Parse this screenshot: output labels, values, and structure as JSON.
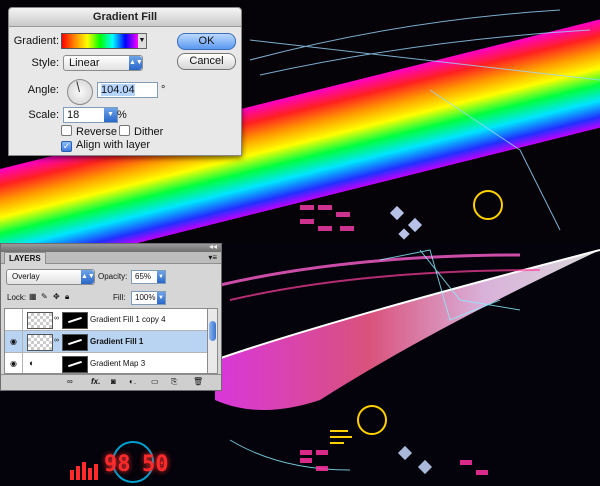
{
  "dialog": {
    "title": "Gradient Fill",
    "gradient_label": "Gradient:",
    "style_label": "Style:",
    "style_value": "Linear",
    "angle_label": "Angle:",
    "angle_value": "104.04",
    "angle_unit": "°",
    "scale_label": "Scale:",
    "scale_value": "18",
    "scale_unit": "%",
    "reverse_label": "Reverse",
    "dither_label": "Dither",
    "align_label": "Align with layer",
    "ok_label": "OK",
    "cancel_label": "Cancel"
  },
  "layers_panel": {
    "tab_label": "LAYERS",
    "blend_mode": "Overlay",
    "opacity_label": "Opacity:",
    "opacity_value": "65%",
    "lock_label": "Lock:",
    "fill_label": "Fill:",
    "fill_value": "100%",
    "layers": [
      {
        "name": "Gradient Fill 1 copy 4",
        "visible": false,
        "active": false
      },
      {
        "name": "Gradient Fill 1",
        "visible": true,
        "active": true
      },
      {
        "name": "Gradient Map 3",
        "visible": true,
        "active": false
      }
    ]
  },
  "readout": {
    "left_value": "98",
    "right_value": "50"
  },
  "colors": {
    "accent_blue": "#3d7ae0",
    "selected_layer": "#b9d3f2",
    "led_red": "#ff2a2a"
  }
}
